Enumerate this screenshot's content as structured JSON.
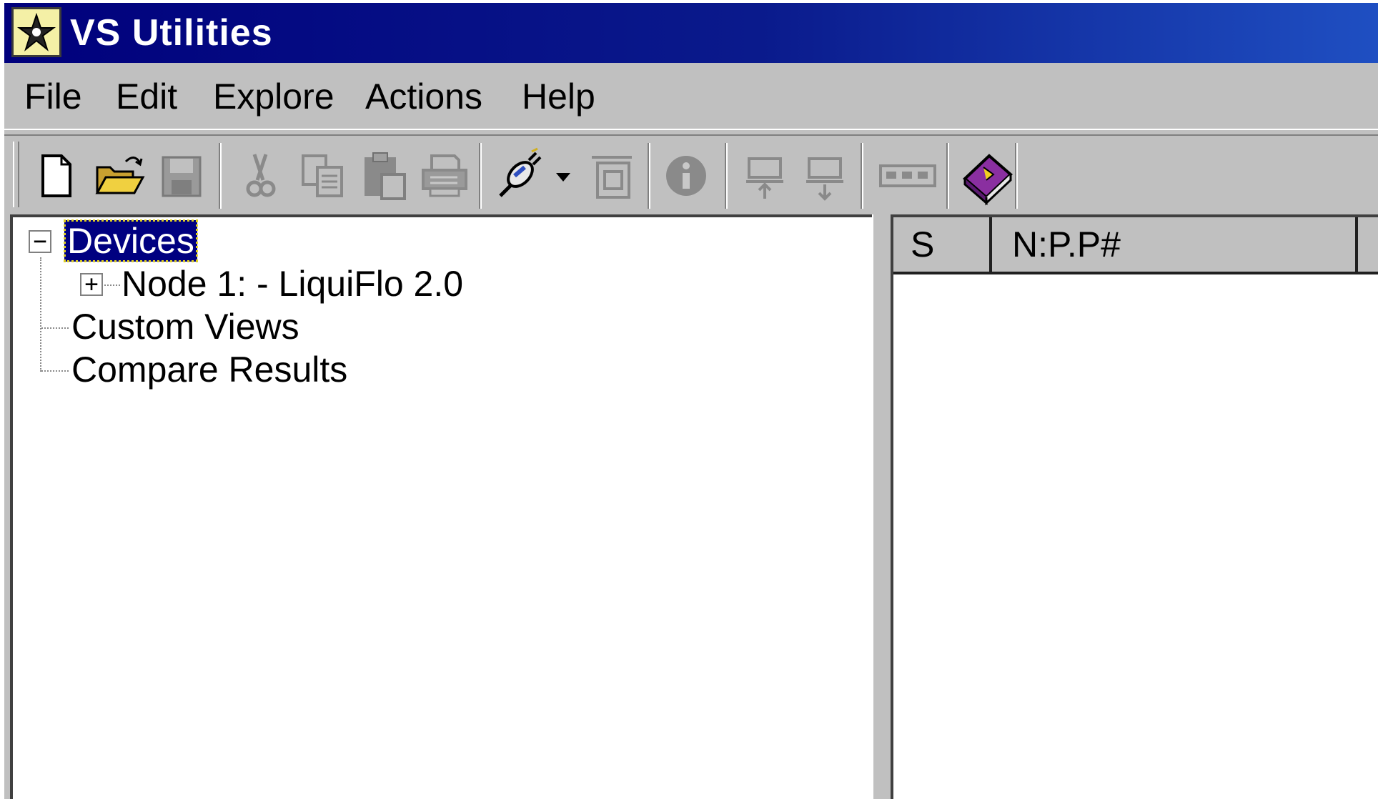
{
  "window": {
    "title": "VS Utilities",
    "icon": "vs-utilities-app-icon"
  },
  "menu": [
    "File",
    "Edit",
    "Explore",
    "Actions",
    "Help"
  ],
  "toolbar": {
    "buttons": [
      {
        "icon": "new-file-icon",
        "enabled": true
      },
      {
        "icon": "open-folder-icon",
        "enabled": true
      },
      {
        "icon": "save-disk-icon",
        "enabled": false
      },
      {
        "icon": "cut-scissors-icon",
        "enabled": false
      },
      {
        "icon": "copy-icon",
        "enabled": false
      },
      {
        "icon": "paste-icon",
        "enabled": false
      },
      {
        "icon": "print-icon",
        "enabled": false
      },
      {
        "icon": "connect-plug-icon",
        "enabled": true
      },
      {
        "icon": "dropdown-arrow-icon",
        "enabled": true
      },
      {
        "icon": "properties-window-icon",
        "enabled": false
      },
      {
        "icon": "info-icon",
        "enabled": false
      },
      {
        "icon": "upload-device-icon",
        "enabled": false
      },
      {
        "icon": "download-device-icon",
        "enabled": false
      },
      {
        "icon": "display-panel-icon",
        "enabled": false
      },
      {
        "icon": "help-book-icon",
        "enabled": true
      }
    ]
  },
  "tree": {
    "root": {
      "label": "Devices",
      "expander": "−",
      "selected": true
    },
    "children": [
      {
        "label": "Node 1: - LiquiFlo 2.0",
        "expander": "+"
      },
      {
        "label": "Custom Views"
      },
      {
        "label": "Compare Results"
      }
    ]
  },
  "list": {
    "columns": [
      "S",
      "N:P.P#",
      ""
    ]
  },
  "colors": {
    "titlebar_start": "#00007c",
    "titlebar_end": "#1f4fc2",
    "chrome": "#c0c0c0",
    "selection": "#000080",
    "book_purple": "#8a2fa0"
  }
}
